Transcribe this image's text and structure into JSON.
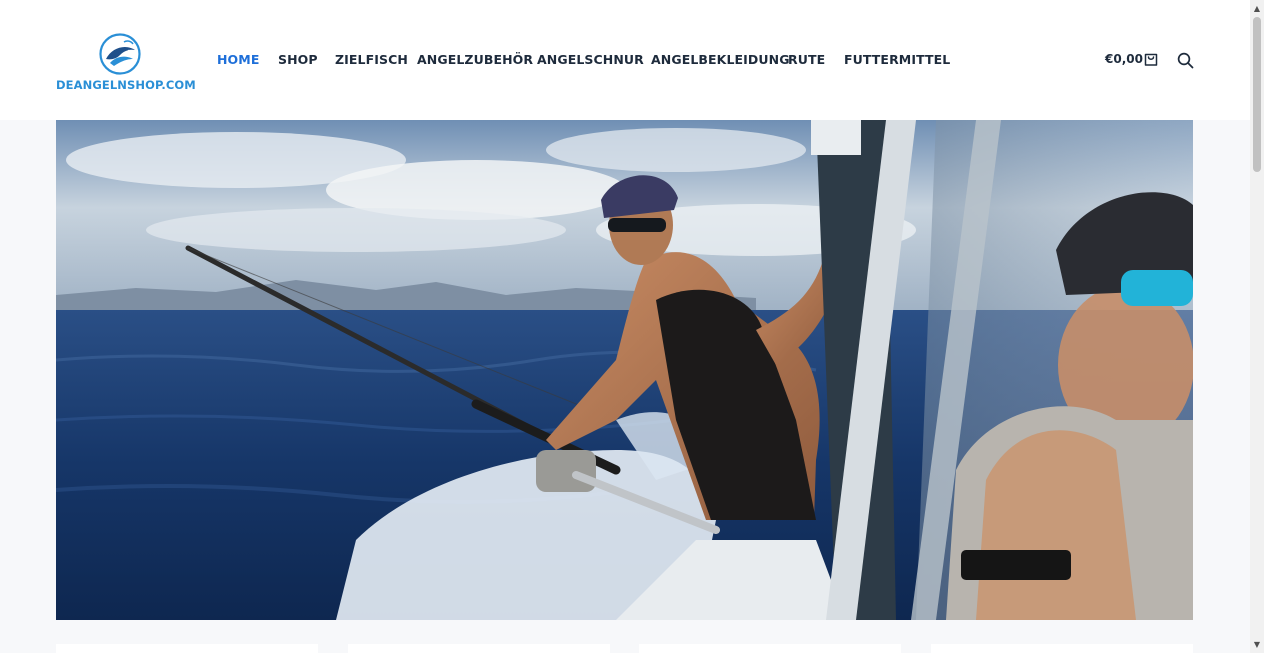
{
  "site": {
    "logo_text": "DEANGELNSHOP.COM",
    "brand_color": "#2a8fd6"
  },
  "nav": {
    "items": [
      {
        "label": "HOME",
        "active": true
      },
      {
        "label": "SHOP"
      },
      {
        "label": "ZIELFISCH"
      },
      {
        "label": "ANGELZUBEHÖR"
      },
      {
        "label": "ANGELSCHNUR"
      },
      {
        "label": "ANGELBEKLEIDUNG"
      },
      {
        "label": "RUTE"
      },
      {
        "label": "FUTTERMITTEL"
      }
    ],
    "active_color": "#1e6fd9",
    "text_color": "#1e2b3c"
  },
  "header_actions": {
    "cart_total": "€0,00",
    "cart_icon": "shopping-bag-icon",
    "search_icon": "search-icon"
  },
  "hero": {
    "image_icon": "hero-fishing-photo"
  }
}
